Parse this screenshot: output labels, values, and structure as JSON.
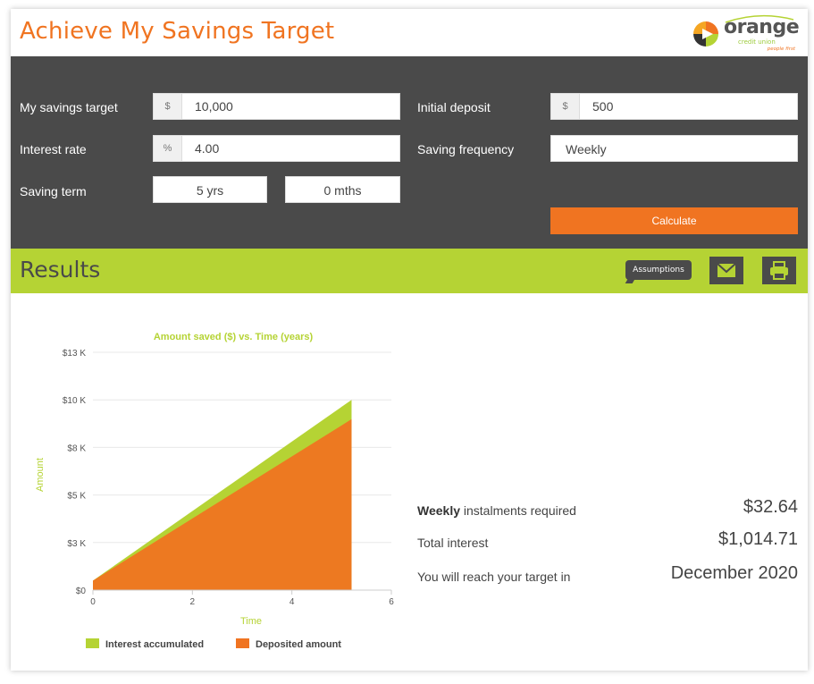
{
  "header": {
    "title": "Achieve My Savings Target"
  },
  "logo": {
    "word": "orange",
    "sub": "credit union",
    "tagline": "people first"
  },
  "form": {
    "savings_target": {
      "label": "My savings target",
      "prefix": "$",
      "value": "10,000"
    },
    "interest_rate": {
      "label": "Interest rate",
      "prefix": "%",
      "value": "4.00"
    },
    "saving_term": {
      "label": "Saving term",
      "years": "5 yrs",
      "months": "0 mths"
    },
    "initial_deposit": {
      "label": "Initial deposit",
      "prefix": "$",
      "value": "500"
    },
    "saving_frequency": {
      "label": "Saving frequency",
      "value": "Weekly"
    },
    "calculate_label": "Calculate"
  },
  "results": {
    "title": "Results",
    "assumptions_label": "Assumptions",
    "instalments": {
      "bold": "Weekly",
      "label": " instalments required",
      "value": "$32.64"
    },
    "total_interest": {
      "label": "Total interest",
      "value": "$1,014.71"
    },
    "reach_target": {
      "label": "You will reach your target in",
      "value": "December 2020"
    }
  },
  "colors": {
    "orange": "#f07421",
    "green": "#b5d334",
    "dark": "#4a4a4a"
  },
  "icons": {
    "email": "envelope-icon",
    "print": "printer-icon"
  },
  "chart_data": {
    "type": "area",
    "title": "Amount saved ($) vs. Time (years)",
    "xlabel": "Time",
    "ylabel": "Amount",
    "xlim": [
      0,
      6
    ],
    "ylim": [
      0,
      12500
    ],
    "x_ticks": [
      "0",
      "2",
      "4",
      "6"
    ],
    "y_ticks": [
      "$0",
      "$3 K",
      "$5 K",
      "$8 K",
      "$10 K",
      "$13 K"
    ],
    "grid": true,
    "legend_position": "bottom",
    "x": [
      0,
      5.2
    ],
    "series": [
      {
        "name": "Interest accumulated",
        "color": "#b5d334",
        "values": [
          500,
          10000
        ]
      },
      {
        "name": "Deposited amount",
        "color": "#f07421",
        "values": [
          500,
          8985
        ]
      }
    ]
  }
}
